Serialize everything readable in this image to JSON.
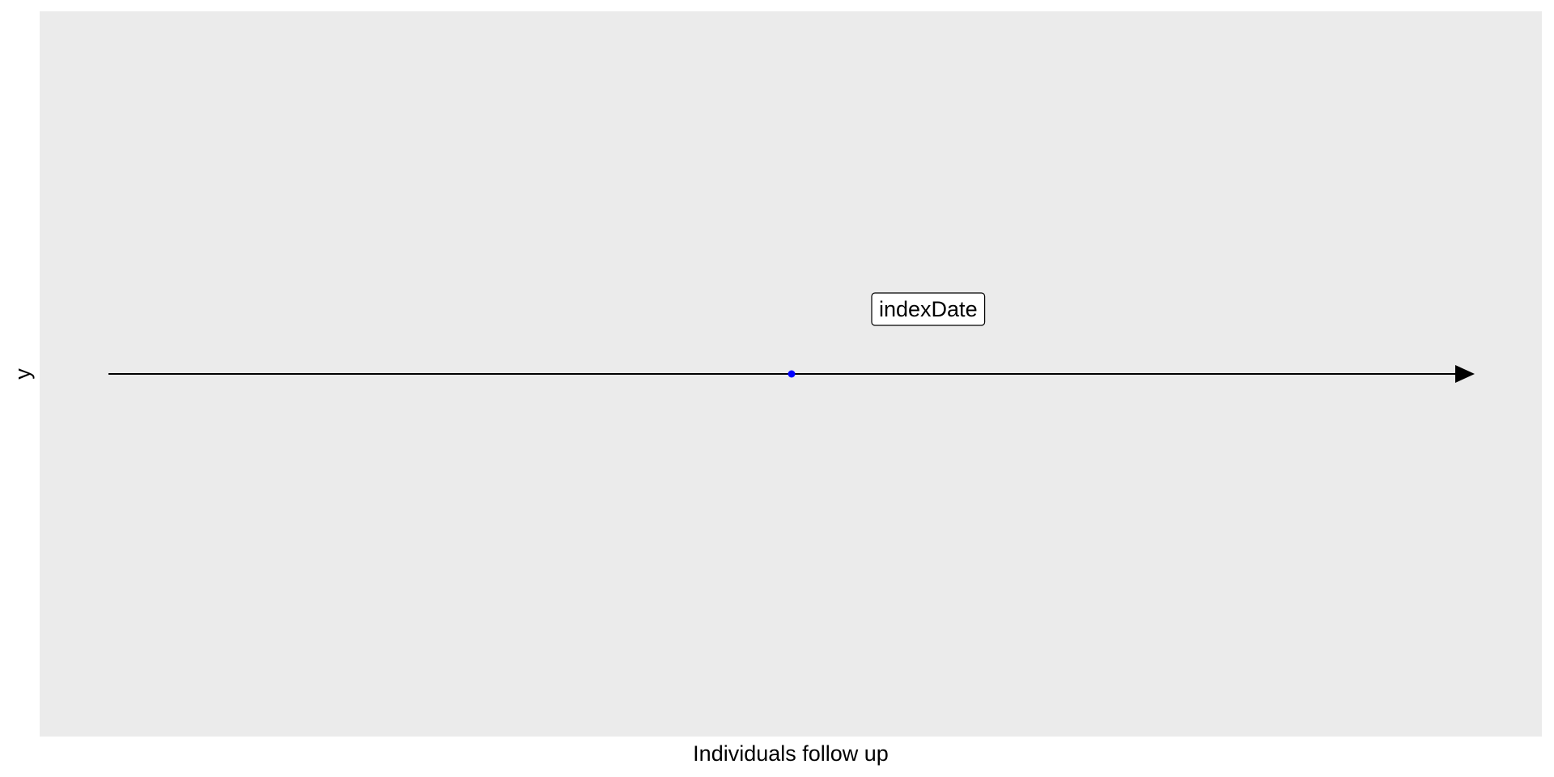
{
  "chart_data": {
    "type": "scatter",
    "title": "",
    "xlabel": "Individuals follow up",
    "ylabel": "y",
    "xlim": [
      0,
      1
    ],
    "grid": false,
    "legend": false,
    "timeline": {
      "start": 0,
      "end": 1,
      "arrow": true
    },
    "points": [
      {
        "x": 0.5,
        "y": 0
      }
    ],
    "annotations": [
      {
        "text": "indexDate",
        "x": 0.6,
        "y": 1
      }
    ]
  },
  "colors": {
    "panel_background": "#EBEBEB",
    "timeline": "#000000",
    "point": "#0000FF"
  }
}
